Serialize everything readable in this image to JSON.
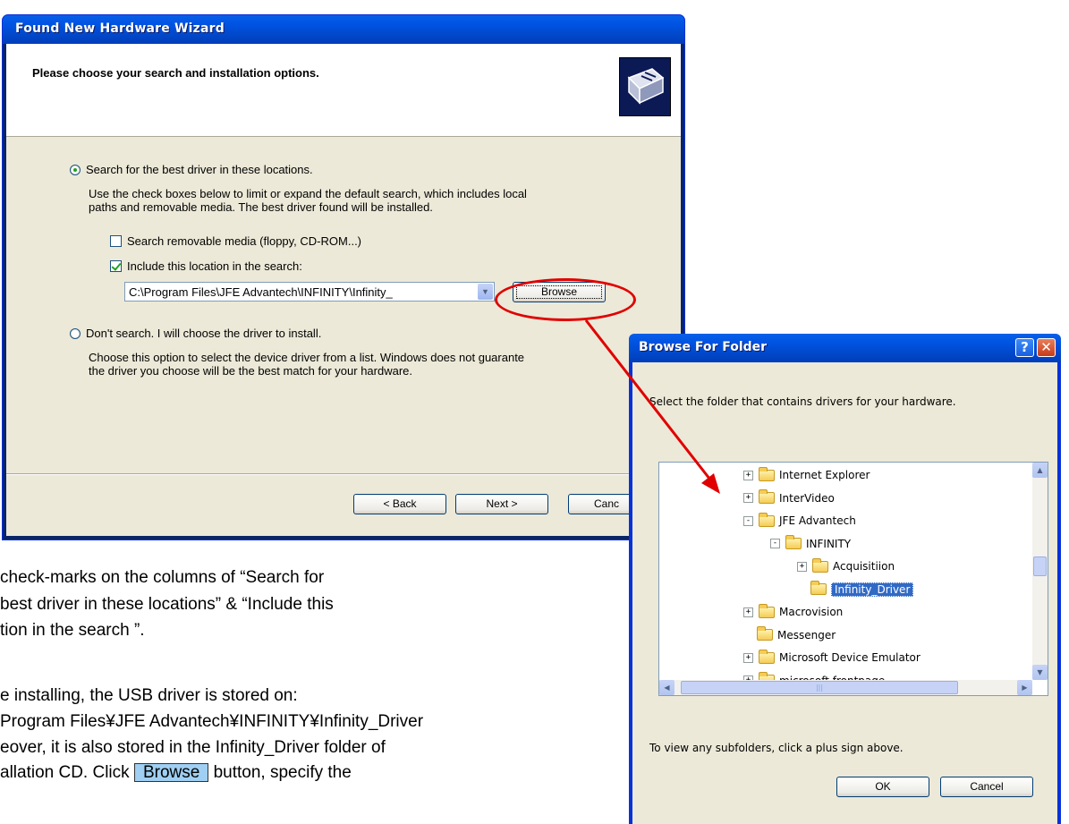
{
  "wizard": {
    "title": "Found New Hardware Wizard",
    "heading": "Please choose your search and installation options.",
    "option_search": "Search for the best driver in these locations.",
    "search_desc_line1": "Use the check boxes below to limit or expand the default search, which includes local",
    "search_desc_line2": "paths and removable media. The best driver found will be installed.",
    "check_removable": "Search removable media (floppy, CD-ROM...)",
    "check_location": "Include this location in the search:",
    "location_value": "C:\\Program Files\\JFE Advantech\\INFINITY\\Infinity_",
    "browse_button": "Browse",
    "option_dont_search": "Don't search. I will choose the driver to install.",
    "dont_desc_line1": "Choose this option to select the device driver from a list.  Windows does not guarante",
    "dont_desc_line2": "the driver you choose will be the best match for your hardware.",
    "back_button": "< Back",
    "next_button": "Next >",
    "cancel_button": "Canc"
  },
  "browse_dialog": {
    "title": "Browse For Folder",
    "instruction": "Select the folder that contains drivers for your hardware.",
    "tree": [
      {
        "label": "Internet Explorer",
        "level": 0,
        "expander": "+"
      },
      {
        "label": "InterVideo",
        "level": 0,
        "expander": "+"
      },
      {
        "label": "JFE Advantech",
        "level": 0,
        "expander": "-"
      },
      {
        "label": "INFINITY",
        "level": 1,
        "expander": "-"
      },
      {
        "label": "Acquisitiion",
        "level": 2,
        "expander": "+"
      },
      {
        "label": "Infinity_Driver",
        "level": 2,
        "expander": "",
        "selected": true
      },
      {
        "label": "Macrovision",
        "level": 0,
        "expander": "+"
      },
      {
        "label": "Messenger",
        "level": 0,
        "expander": ""
      },
      {
        "label": "Microsoft Device Emulator",
        "level": 0,
        "expander": "+"
      },
      {
        "label": "microsoft frontpage",
        "level": 0,
        "expander": "+"
      }
    ],
    "hint": "To view any subfolders, click a plus sign above.",
    "ok_button": "OK",
    "cancel_button": "Cancel"
  },
  "document": {
    "line1": "check-marks on the columns of “Search for",
    "line2": "best driver in these locations” & “Include this",
    "line3": "tion in the search ”.",
    "line4": "e installing, the USB driver is stored on:",
    "line5": "Program Files¥JFE Advantech¥INFINITY¥Infinity_Driver",
    "line6": "eover, it is also stored in the Infinity_Driver folder of",
    "line7_a": "allation CD. Click",
    "line7_browse": "Browse",
    "line7_b": "button, specify the"
  }
}
